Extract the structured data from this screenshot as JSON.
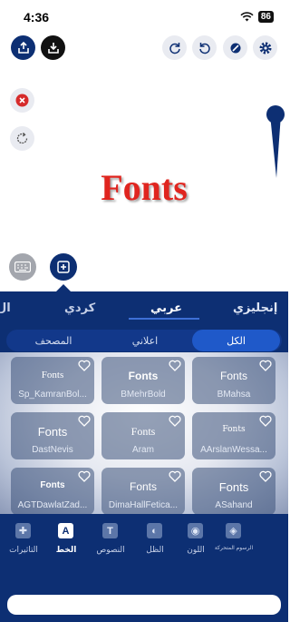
{
  "status": {
    "time": "4:36",
    "battery": "86"
  },
  "toolbar": {
    "share_icon": "share-icon",
    "download_icon": "download-icon",
    "redo_icon": "redo-icon",
    "undo_icon": "undo-icon",
    "clear_icon": "clear-icon",
    "settings_icon": "gear-icon",
    "delete_icon": "close-icon",
    "reset_icon": "reset-icon"
  },
  "canvas": {
    "text": "Fonts"
  },
  "languages": [
    {
      "label": "إنجليزي"
    },
    {
      "label": "عربي"
    },
    {
      "label": "كردي"
    },
    {
      "label": "ال"
    }
  ],
  "categories": [
    {
      "label": "الكل"
    },
    {
      "label": "اعلاني"
    },
    {
      "label": "المصحف"
    }
  ],
  "fonts": [
    {
      "sample": "Fonts",
      "name": "BMahsa"
    },
    {
      "sample": "Fonts",
      "name": "BMehrBold"
    },
    {
      "sample": "Fonts",
      "name": "Sp_KamranBol..."
    },
    {
      "sample": "Fonts",
      "name": "AArslanWessa..."
    },
    {
      "sample": "Fonts",
      "name": "Aram"
    },
    {
      "sample": "Fonts",
      "name": "DastNevis"
    },
    {
      "sample": "Fonts",
      "name": "ASahand"
    },
    {
      "sample": "Fonts",
      "name": "DimaHallFetica..."
    },
    {
      "sample": "Fonts",
      "name": "AGTDawlatZad..."
    }
  ],
  "nav": [
    {
      "label": "الرسوم المتحركة"
    },
    {
      "label": "اللون"
    },
    {
      "label": "الظل"
    },
    {
      "label": "النصوص"
    },
    {
      "label": "الخط"
    },
    {
      "label": "التاثيرات"
    }
  ],
  "colors": {
    "brand": "#0d2f73",
    "accent": "#1f59c9",
    "canvas_text": "#e0251f",
    "delete": "#d62b2b"
  }
}
